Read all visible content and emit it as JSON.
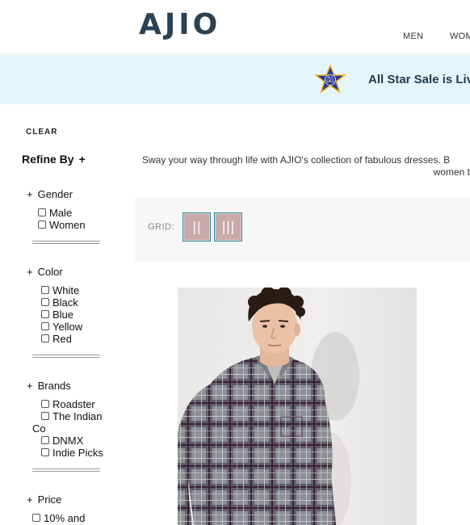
{
  "header": {
    "logo": "AJIO",
    "nav": [
      "MEN",
      "WOM"
    ]
  },
  "banner": {
    "badge_icon": "all-stars-sale-star-badge",
    "text": "All Star Sale is Live!"
  },
  "sidebar": {
    "clear": "CLEAR",
    "refine_by": "Refine By",
    "refine_plus": "+",
    "facets": [
      {
        "title": "Gender",
        "plus": "+",
        "options": [
          "Male",
          "Women"
        ]
      },
      {
        "title": "Color",
        "plus": "+",
        "options": [
          "White",
          "Black",
          "Blue",
          "Yellow",
          "Red"
        ]
      },
      {
        "title": "Brands",
        "plus": "+",
        "options": [
          "Roadster",
          "The Indian",
          "DNMX",
          "Indie Picks"
        ],
        "wrap": "Co"
      },
      {
        "title": "Price",
        "plus": "+",
        "options": [
          "10% and"
        ]
      }
    ]
  },
  "main": {
    "description_line1": "Sway your way through life with AJIO's collection of fabulous dresses. B",
    "description_line2": "women t",
    "grid_label": "GRID:",
    "grid_two": "||",
    "grid_three": "|||"
  },
  "product": {
    "image_icon": "man-in-checked-shirt-photo"
  },
  "colors": {
    "logo": "#2c4152",
    "banner_bg": "#e5f5fc",
    "grid_btn": "#c9a9ab",
    "grid_border": "#2b8a95"
  }
}
